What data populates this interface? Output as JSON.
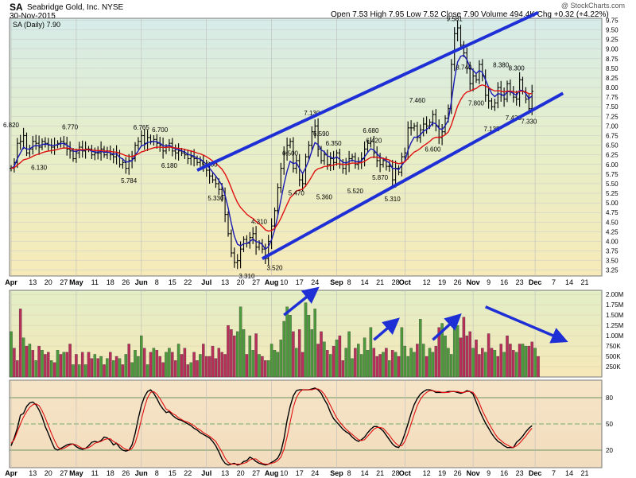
{
  "header": {
    "symbol": "SA",
    "company": "Seabridge Gold, Inc.  NYSE",
    "date": "30-Nov-2015",
    "quote": "Open 7.53  High 7.95  Low 7.52  Close 7.90  Volume 494.4K  Chg +0.32 (+4.22%)",
    "copyright": "@ StockCharts.com"
  },
  "legend": {
    "price": "SA (Daily) 7.90"
  },
  "colors": {
    "price_bar": "#000000",
    "ma_short": "#1a1ab4",
    "ma_long": "#e01010",
    "channel": "#1f2fd6",
    "arrow": "#1f2fd6",
    "vol_up": "#4c9a3c",
    "vol_down": "#b8305a",
    "stoch_k": "#000000",
    "stoch_d": "#e01010"
  },
  "chart_data": [
    {
      "type": "ohlc",
      "panel": "price",
      "ylim": [
        3.1,
        9.8
      ],
      "yticks": [
        "9.75",
        "9.50",
        "9.25",
        "9.00",
        "8.75",
        "8.50",
        "8.25",
        "8.00",
        "7.75",
        "7.50",
        "7.25",
        "7.00",
        "6.75",
        "6.50",
        "6.25",
        "6.00",
        "5.75",
        "5.50",
        "5.25",
        "5.00",
        "4.75",
        "4.50",
        "4.25",
        "4.00",
        "3.75",
        "3.50",
        "3.25"
      ],
      "close": [
        5.9,
        6.05,
        6.55,
        6.6,
        6.75,
        6.3,
        6.4,
        6.6,
        6.55,
        6.45,
        6.6,
        6.55,
        6.5,
        6.45,
        6.5,
        6.55,
        6.6,
        6.55,
        6.4,
        6.35,
        6.15,
        6.3,
        6.45,
        6.35,
        6.4,
        6.4,
        6.25,
        6.3,
        6.3,
        6.4,
        6.25,
        6.35,
        6.25,
        6.2,
        6.3,
        6.0,
        6.05,
        5.9,
        6.1,
        6.15,
        6.5,
        6.6,
        6.75,
        6.55,
        6.7,
        6.6,
        6.65,
        6.55,
        6.5,
        6.35,
        6.45,
        6.55,
        6.35,
        6.3,
        6.35,
        6.3,
        6.25,
        6.15,
        6.2,
        6.15,
        6.05,
        6.1,
        5.95,
        5.85,
        5.7,
        5.6,
        5.5,
        5.35,
        5.2,
        4.7,
        4.2,
        3.7,
        3.45,
        3.5,
        3.8,
        4.05,
        3.95,
        4.1,
        4.2,
        3.85,
        3.95,
        3.8,
        3.55,
        4.0,
        4.4,
        4.8,
        5.4,
        5.9,
        6.3,
        6.5,
        6.6,
        5.9,
        6.1,
        5.6,
        5.5,
        6.2,
        6.5,
        6.85,
        7.0,
        6.4,
        6.1,
        6.25,
        6.0,
        6.15,
        6.05,
        6.3,
        6.0,
        5.9,
        6.0,
        6.15,
        6.2,
        6.0,
        6.05,
        6.15,
        6.4,
        6.55,
        6.6,
        6.3,
        6.1,
        6.0,
        6.1,
        5.95,
        5.95,
        5.6,
        5.9,
        5.8,
        6.2,
        6.3,
        6.95,
        6.95,
        7.0,
        6.7,
        6.9,
        7.05,
        7.0,
        7.1,
        7.3,
        7.0,
        6.7,
        6.85,
        7.2,
        7.45,
        8.6,
        9.4,
        9.55,
        9.1,
        8.9,
        8.5,
        8.1,
        8.3,
        8.2,
        8.6,
        8.3,
        7.8,
        7.65,
        7.5,
        7.6,
        8.0,
        7.8,
        7.7,
        8.1,
        7.9,
        7.75,
        7.7,
        8.2,
        7.9,
        7.7,
        7.45,
        7.9
      ],
      "series": [
        {
          "name": "MA short"
        },
        {
          "name": "MA long"
        }
      ],
      "data_labels": [
        "6.820",
        "6.770",
        "6.130",
        "6.765",
        "6.700",
        "6.180",
        "5.784",
        "5.800",
        "5.330",
        "4.310",
        "3.310",
        "3.520",
        "6.500",
        "7.130",
        "5.470",
        "6.590",
        "5.360",
        "6.350",
        "5.520",
        "6.680",
        "6.420",
        "5.870",
        "5.310",
        "7.460",
        "6.600",
        "9.581",
        "8.740",
        "7.800",
        "7.135",
        "8.380",
        "7.420",
        "8.300",
        "7.330"
      ],
      "channel": {
        "upper": [
          [
            60,
            5.85
          ],
          [
            170,
            9.95
          ]
        ],
        "lower": [
          [
            81,
            3.55
          ],
          [
            178,
            7.85
          ]
        ]
      }
    },
    {
      "type": "bar",
      "panel": "volume",
      "ylim": [
        0,
        2100
      ],
      "yticks": [
        "2.00M",
        "1.75M",
        "1.50M",
        "1.25M",
        "1.00M",
        "750K",
        "500K",
        "250K"
      ],
      "volume_k": [
        1100,
        700,
        400,
        1650,
        950,
        750,
        800,
        650,
        400,
        750,
        650,
        550,
        600,
        400,
        350,
        650,
        550,
        600,
        600,
        800,
        300,
        550,
        300,
        600,
        300,
        600,
        450,
        550,
        450,
        500,
        300,
        450,
        600,
        400,
        500,
        450,
        300,
        550,
        800,
        350,
        650,
        500,
        1000,
        700,
        300,
        600,
        700,
        650,
        500,
        350,
        600,
        700,
        600,
        400,
        800,
        550,
        700,
        300,
        350,
        600,
        400,
        550,
        800,
        500,
        500,
        750,
        450,
        700,
        600,
        550,
        1250,
        1150,
        1000,
        1100,
        1700,
        1150,
        550,
        1000,
        650,
        1050,
        550,
        500,
        400,
        400,
        800,
        650,
        600,
        900,
        1350,
        1700,
        1500,
        1100,
        700,
        1150,
        600,
        1800,
        1500,
        1150,
        1650,
        800,
        1100,
        850,
        650,
        550,
        750,
        900,
        1000,
        400,
        700,
        1100,
        450,
        700,
        800,
        550,
        950,
        650,
        1200,
        700,
        500,
        550,
        600,
        700,
        400,
        650,
        600,
        500,
        1200,
        750,
        500,
        700,
        600,
        800,
        1400,
        800,
        500,
        700,
        600,
        750,
        1200,
        1300,
        1000,
        700,
        550,
        1350,
        1250,
        950,
        1450,
        1000,
        1100,
        700,
        900,
        550,
        700,
        600,
        1050,
        700,
        650,
        500,
        800,
        600,
        1000,
        800,
        650,
        600,
        800,
        800,
        750,
        750,
        850,
        700,
        500
      ],
      "up": [
        1,
        0,
        0,
        0,
        1,
        0,
        1,
        0,
        1,
        0,
        1,
        0,
        0,
        1,
        0,
        1,
        0,
        1,
        0,
        0,
        1,
        0,
        1,
        0,
        1,
        0,
        0,
        1,
        0,
        1,
        0,
        1,
        0,
        1,
        0,
        1,
        0,
        1,
        0,
        1,
        1,
        1,
        1,
        0,
        1,
        0,
        1,
        0,
        0,
        0,
        1,
        1,
        0,
        0,
        1,
        0,
        0,
        0,
        1,
        0,
        0,
        1,
        0,
        0,
        0,
        0,
        0,
        0,
        0,
        0,
        0,
        0,
        0,
        1,
        1,
        1,
        0,
        1,
        1,
        0,
        1,
        0,
        0,
        1,
        1,
        1,
        1,
        1,
        1,
        1,
        1,
        0,
        1,
        0,
        0,
        1,
        1,
        1,
        1,
        0,
        0,
        1,
        0,
        1,
        0,
        1,
        0,
        0,
        1,
        1,
        1,
        0,
        1,
        1,
        1,
        1,
        1,
        0,
        0,
        0,
        1,
        0,
        1,
        0,
        1,
        0,
        1,
        1,
        1,
        1,
        1,
        0,
        1,
        1,
        0,
        1,
        1,
        0,
        0,
        1,
        1,
        1,
        1,
        1,
        1,
        0,
        0,
        0,
        0,
        1,
        0,
        0,
        0,
        1,
        0,
        0,
        1,
        0,
        0,
        1,
        0,
        0,
        0,
        1,
        0,
        1,
        1,
        0,
        0,
        1
      ]
    },
    {
      "type": "line",
      "panel": "stochastic",
      "ylim": [
        0,
        100
      ],
      "yticks": [
        "80",
        "50",
        "20"
      ],
      "series": [
        {
          "name": "%K",
          "values": [
            25,
            34,
            45,
            60,
            62,
            70,
            74,
            75,
            72,
            66,
            58,
            47,
            39,
            30,
            22,
            20,
            22,
            24,
            26,
            27,
            27,
            24,
            22,
            21,
            22,
            25,
            29,
            30,
            29,
            31,
            35,
            34,
            31,
            26,
            28,
            23,
            20,
            19,
            20,
            26,
            39,
            56,
            71,
            81,
            87,
            89,
            85,
            79,
            72,
            67,
            63,
            64,
            60,
            57,
            55,
            54,
            52,
            50,
            48,
            45,
            43,
            40,
            38,
            36,
            34,
            30,
            25,
            18,
            10,
            5,
            3,
            4,
            5,
            3,
            4,
            7,
            8,
            12,
            10,
            7,
            5,
            4,
            3,
            4,
            6,
            8,
            11,
            18,
            33,
            54,
            70,
            82,
            88,
            89,
            89,
            89,
            89,
            90,
            91,
            89,
            85,
            78,
            72,
            63,
            56,
            52,
            48,
            44,
            41,
            39,
            35,
            32,
            30,
            32,
            35,
            40,
            44,
            47,
            47,
            45,
            42,
            37,
            32,
            27,
            24,
            23,
            29,
            39,
            50,
            62,
            72,
            79,
            84,
            87,
            89,
            89,
            88,
            86,
            86,
            86,
            86,
            87,
            87,
            87,
            86,
            85,
            86,
            88,
            87,
            84,
            75,
            66,
            58,
            51,
            45,
            39,
            34,
            30,
            28,
            25,
            23,
            23,
            23,
            29,
            32,
            36,
            41,
            45,
            48
          ]
        },
        {
          "name": "%D",
          "values": [
            28,
            32,
            41,
            50,
            58,
            64,
            69,
            72,
            73,
            71,
            65,
            57,
            48,
            39,
            31,
            24,
            21,
            22,
            24,
            26,
            27,
            26,
            24,
            22,
            22,
            23,
            25,
            28,
            29,
            30,
            32,
            33,
            33,
            30,
            28,
            26,
            23,
            21,
            20,
            22,
            28,
            40,
            55,
            69,
            80,
            86,
            87,
            84,
            79,
            73,
            67,
            65,
            62,
            60,
            57,
            55,
            53,
            52,
            50,
            48,
            45,
            43,
            40,
            38,
            36,
            33,
            30,
            24,
            18,
            11,
            6,
            4,
            4,
            4,
            4,
            5,
            6,
            9,
            10,
            10,
            7,
            5,
            4,
            4,
            5,
            6,
            8,
            12,
            21,
            35,
            52,
            69,
            80,
            86,
            89,
            89,
            89,
            89,
            90,
            90,
            88,
            84,
            78,
            71,
            64,
            57,
            52,
            48,
            44,
            41,
            38,
            35,
            32,
            31,
            32,
            36,
            40,
            44,
            46,
            46,
            45,
            41,
            37,
            32,
            28,
            25,
            25,
            30,
            39,
            50,
            61,
            71,
            78,
            83,
            86,
            88,
            88,
            87,
            87,
            86,
            86,
            86,
            87,
            87,
            87,
            86,
            86,
            87,
            87,
            86,
            81,
            74,
            65,
            58,
            51,
            45,
            39,
            34,
            31,
            28,
            26,
            24,
            23,
            25,
            28,
            32,
            36,
            41,
            45
          ]
        }
      ]
    }
  ],
  "xaxis": {
    "labels": [
      {
        "t": "Apr",
        "i": 0,
        "bold": true
      },
      {
        "t": "13",
        "i": 7
      },
      {
        "t": "20",
        "i": 12
      },
      {
        "t": "27",
        "i": 17
      },
      {
        "t": "May",
        "i": 21,
        "bold": true
      },
      {
        "t": "11",
        "i": 27
      },
      {
        "t": "18",
        "i": 32
      },
      {
        "t": "26",
        "i": 37
      },
      {
        "t": "Jun",
        "i": 42,
        "bold": true
      },
      {
        "t": "8",
        "i": 47
      },
      {
        "t": "15",
        "i": 52
      },
      {
        "t": "22",
        "i": 57
      },
      {
        "t": "Jul",
        "i": 63,
        "bold": true
      },
      {
        "t": "13",
        "i": 69
      },
      {
        "t": "20",
        "i": 74
      },
      {
        "t": "27",
        "i": 79
      },
      {
        "t": "Aug",
        "i": 84,
        "bold": true
      },
      {
        "t": "10",
        "i": 88
      },
      {
        "t": "17",
        "i": 93
      },
      {
        "t": "24",
        "i": 98
      },
      {
        "t": "Sep",
        "i": 105,
        "bold": true
      },
      {
        "t": "8",
        "i": 109
      },
      {
        "t": "14",
        "i": 114
      },
      {
        "t": "21",
        "i": 119
      },
      {
        "t": "28",
        "i": 124
      },
      {
        "t": "Oct",
        "i": 127,
        "bold": true
      },
      {
        "t": "12",
        "i": 134
      },
      {
        "t": "19",
        "i": 139
      },
      {
        "t": "26",
        "i": 144
      },
      {
        "t": "Nov",
        "i": 149,
        "bold": true
      },
      {
        "t": "9",
        "i": 154
      },
      {
        "t": "16",
        "i": 159
      },
      {
        "t": "23",
        "i": 164
      },
      {
        "t": "Dec",
        "i": 169,
        "bold": true
      },
      {
        "t": "7",
        "i": 175
      },
      {
        "t": "14",
        "i": 180
      },
      {
        "t": "21",
        "i": 185
      }
    ]
  }
}
